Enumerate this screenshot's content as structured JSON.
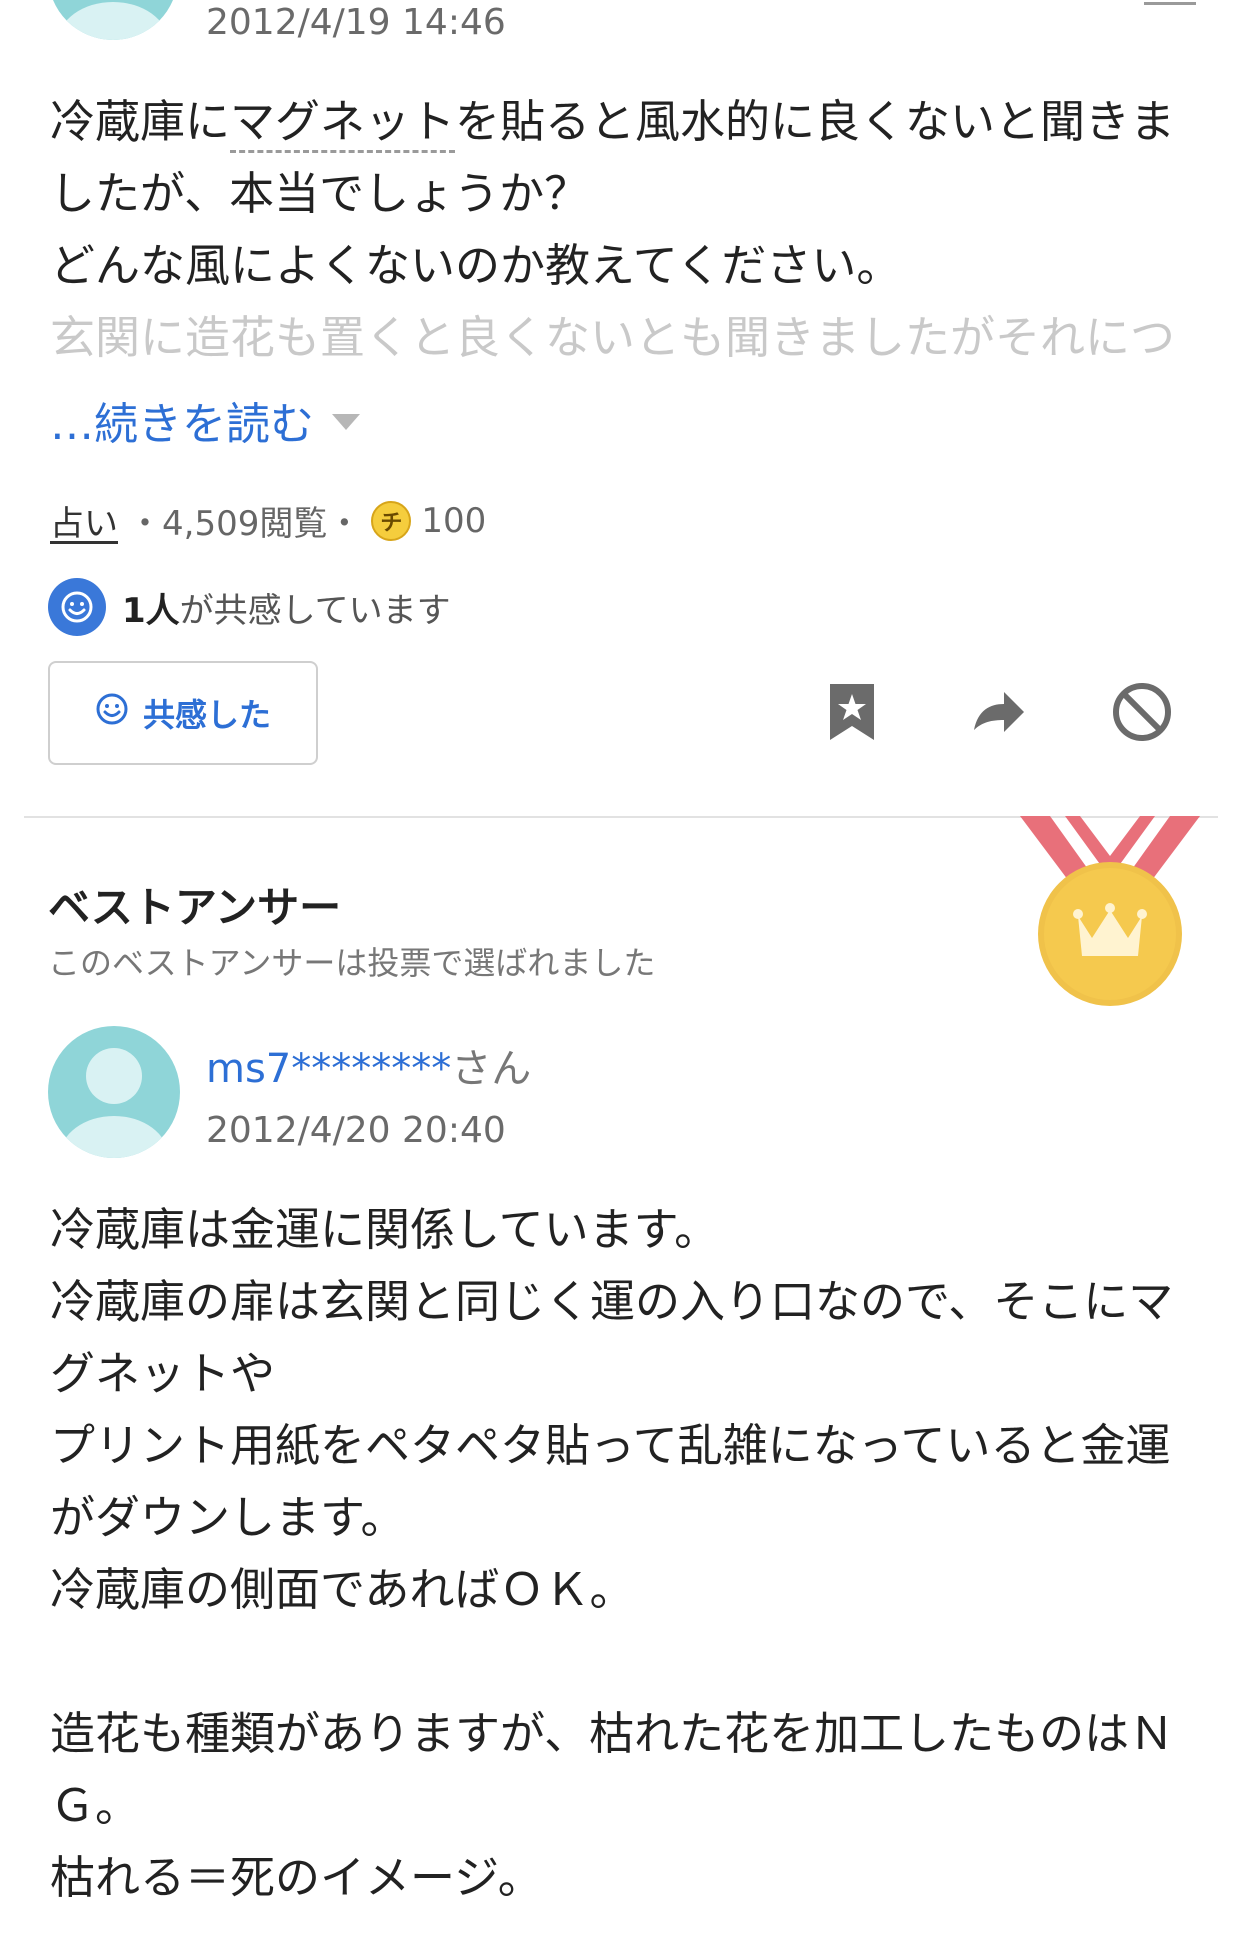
{
  "question": {
    "date": "2012/4/19 14:46",
    "lines": [
      {
        "before": "冷蔵庫に",
        "highlight": "マグネット",
        "after": "を貼ると風水的に良くないと聞きま"
      },
      {
        "text": "したが、本当でしょうか？"
      },
      {
        "text": "どんな風によくないのか教えてください。"
      },
      {
        "text": "玄関に造花も置くと良くないとも聞きましたがそれにつ"
      }
    ],
    "read_more": "…続きを読む",
    "category": "占い",
    "views": "・4,509閲覧・",
    "coin_symbol": "チ",
    "coins": "100",
    "empathy_count": "1人",
    "empathy_text": "が共感しています",
    "empathy_button": "共感した"
  },
  "icons": {
    "bookmark": "bookmark-icon",
    "share": "share-icon",
    "block": "block-icon",
    "smile": "smile-icon",
    "medal": "medal-crown-icon"
  },
  "best_answer": {
    "title": "ベストアンサー",
    "subtitle": "このベストアンサーは投票で選ばれました",
    "user": "ms7********",
    "user_suffix": "さん",
    "date": "2012/4/20 20:40",
    "lines": [
      "冷蔵庫は金運に関係しています。",
      "冷蔵庫の扉は玄関と同じく運の入り口なので、そこにマ",
      "グネットや",
      "プリント用紙をペタペタ貼って乱雑になっていると金運",
      "がダウンします。",
      "冷蔵庫の側面であればＯＫ。",
      "",
      "造花も種類がありますが、枯れた花を加工したものはＮ",
      "Ｇ。",
      "枯れる＝死のイメージ。"
    ]
  },
  "colors": {
    "link_blue": "#2d6fd5",
    "avatar_teal": "#8fd5d8",
    "medal_gold": "#f5c94e",
    "ribbon_red": "#e8707a"
  }
}
